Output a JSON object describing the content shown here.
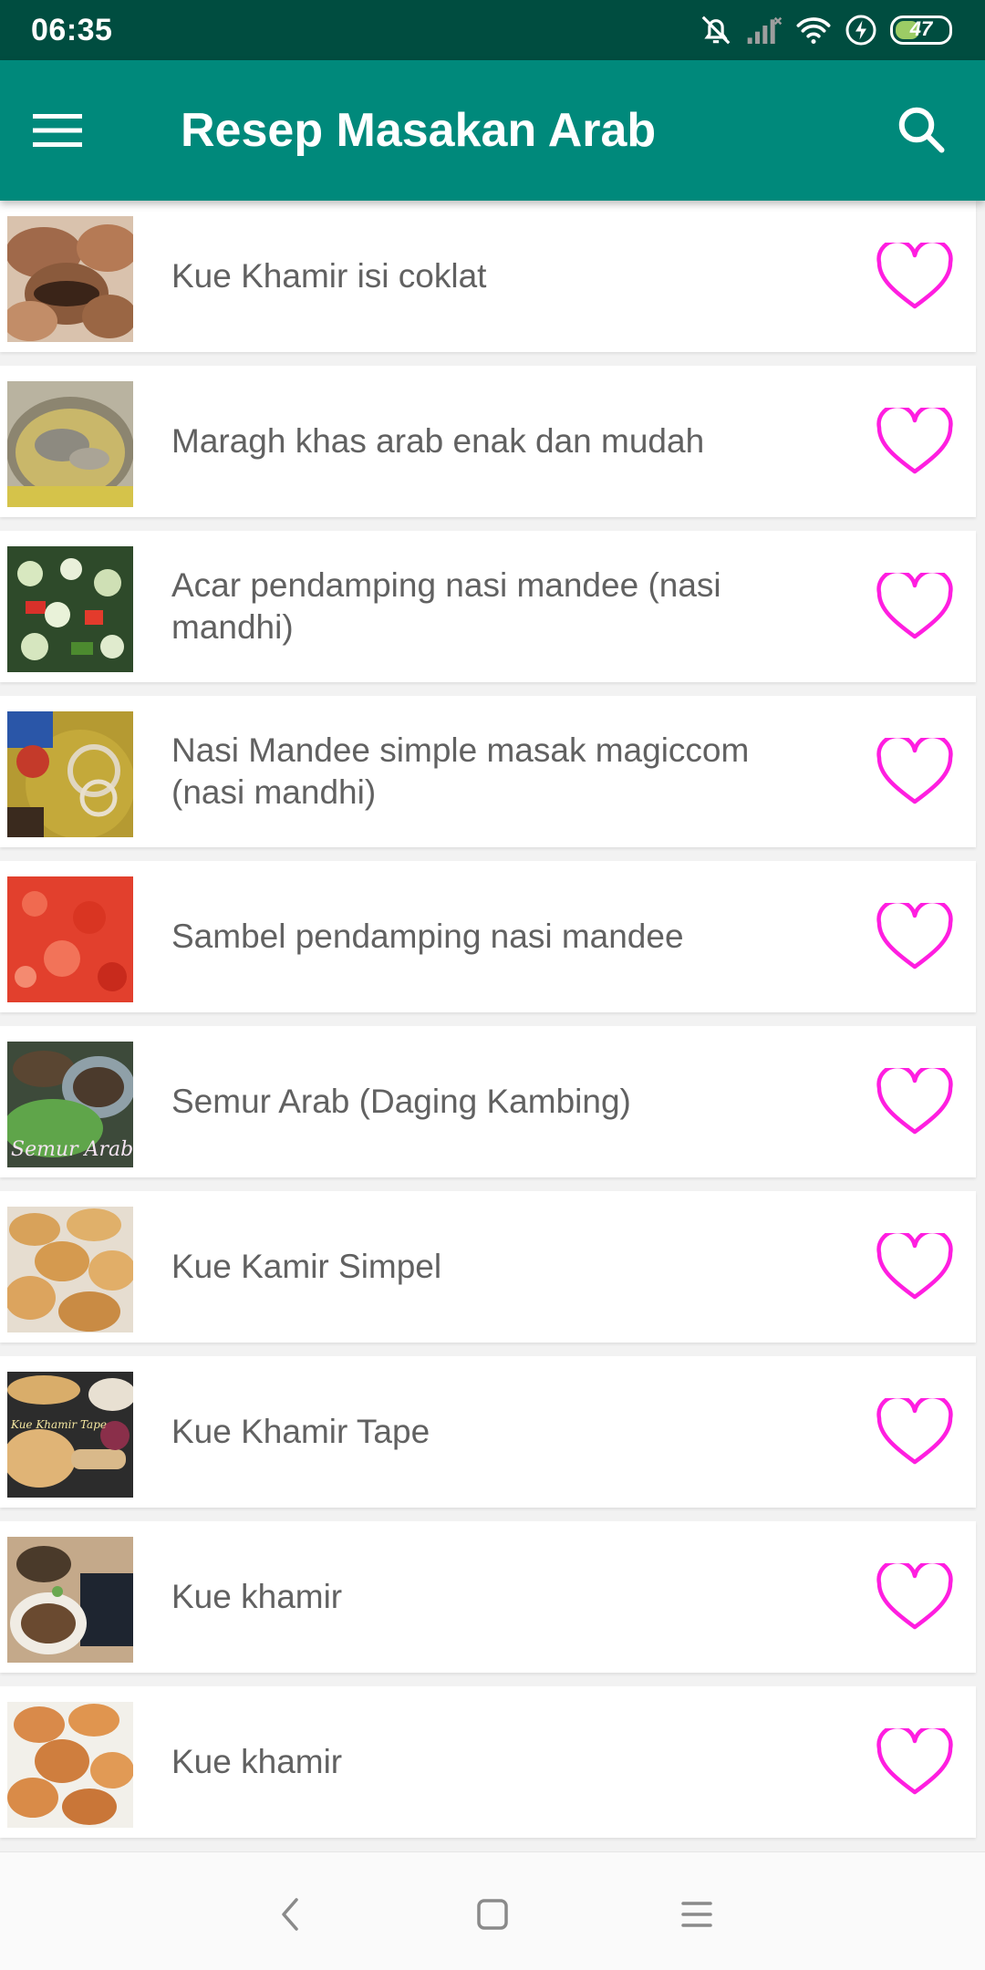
{
  "status_bar": {
    "time": "06:35",
    "battery": "47",
    "battery_level": 0.47,
    "icons": [
      "mute-alarm-icon",
      "signal-icon",
      "wifi-icon",
      "charging-icon",
      "battery-icon"
    ]
  },
  "app_bar": {
    "title": "Resep Masakan Arab",
    "menu_icon": "hamburger-menu-icon",
    "search_icon": "search-icon"
  },
  "colors": {
    "status_bar": "#004d40",
    "app_bar": "#00897b",
    "heart": "#ff1ee0",
    "item_text": "#616161",
    "list_bg": "#f2f2f2"
  },
  "recipes": [
    {
      "title": "Kue Khamir isi coklat",
      "thumb": "khamir-coklat-photo"
    },
    {
      "title": "Maragh khas arab enak dan mudah",
      "thumb": "maragh-soup-photo"
    },
    {
      "title": "Acar pendamping nasi mandee (nasi mandhi)",
      "thumb": "acar-salad-photo"
    },
    {
      "title": "Nasi Mandee simple masak magiccom (nasi mandhi)",
      "thumb": "nasi-mandee-photo"
    },
    {
      "title": "Sambel pendamping nasi mandee",
      "thumb": "sambel-photo"
    },
    {
      "title": "Semur Arab (Daging Kambing)",
      "thumb": "semur-arab-photo",
      "overlay_text": "Semur Arab"
    },
    {
      "title": "Kue Kamir Simpel",
      "thumb": "kue-kamir-photo"
    },
    {
      "title": "Kue Khamir Tape",
      "thumb": "khamir-tape-photo",
      "overlay_text": "Kue Khamir Tape"
    },
    {
      "title": "Kue khamir",
      "thumb": "kue-khamir-photo-1"
    },
    {
      "title": "Kue khamir",
      "thumb": "kue-khamir-photo-2"
    }
  ],
  "nav_bar": {
    "icons": [
      "back-icon",
      "home-icon",
      "recents-icon"
    ]
  }
}
